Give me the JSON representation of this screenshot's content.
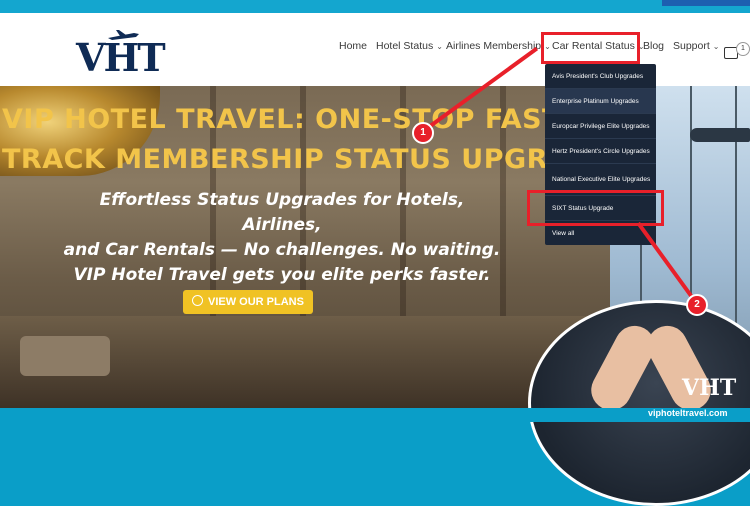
{
  "logo": {
    "text": "VHT"
  },
  "nav": {
    "items": [
      {
        "label": "Home",
        "has_caret": false
      },
      {
        "label": "Hotel Status",
        "has_caret": true
      },
      {
        "label": "Airlines Membership",
        "has_caret": true
      },
      {
        "label": "Car Rental Status",
        "has_caret": true
      },
      {
        "label": "Blog",
        "has_caret": false
      },
      {
        "label": "Support",
        "has_caret": true
      }
    ],
    "cart_count": "1"
  },
  "dropdown": {
    "items": [
      {
        "label": "Avis President's Club Upgrades"
      },
      {
        "label": "Enterprise Platinum Upgrades"
      },
      {
        "label": "Europcar Privilege Elite Upgrades"
      },
      {
        "label": "Hertz President's Circle Upgrades"
      },
      {
        "label": "National Executive Elite Upgrades"
      },
      {
        "label": "SIXT Status Upgrade"
      },
      {
        "label": "View all"
      }
    ]
  },
  "hero": {
    "headline_line1": "VIP HOTEL TRAVEL: ONE-STOP FAST",
    "headline_line2": "TRACK MEMBERSHIP STATUS UPGRADE",
    "sub_line1": "Effortless Status Upgrades for Hotels, Airlines,",
    "sub_line2": "and Car Rentals — No challenges. No waiting.",
    "sub_line3": "VIP Hotel Travel gets you elite perks faster.",
    "cta_label": "VIEW OUR PLANS"
  },
  "annotations": {
    "step1": "1",
    "step2": "2",
    "color": "#e8202a"
  },
  "watermark": {
    "logo": "VHT",
    "domain": "viphoteltravel.com"
  },
  "colors": {
    "accent_gold": "#f2c44a",
    "menu_bg": "#1a2638",
    "cta": "#f0c224",
    "band": "#14a6cf"
  }
}
